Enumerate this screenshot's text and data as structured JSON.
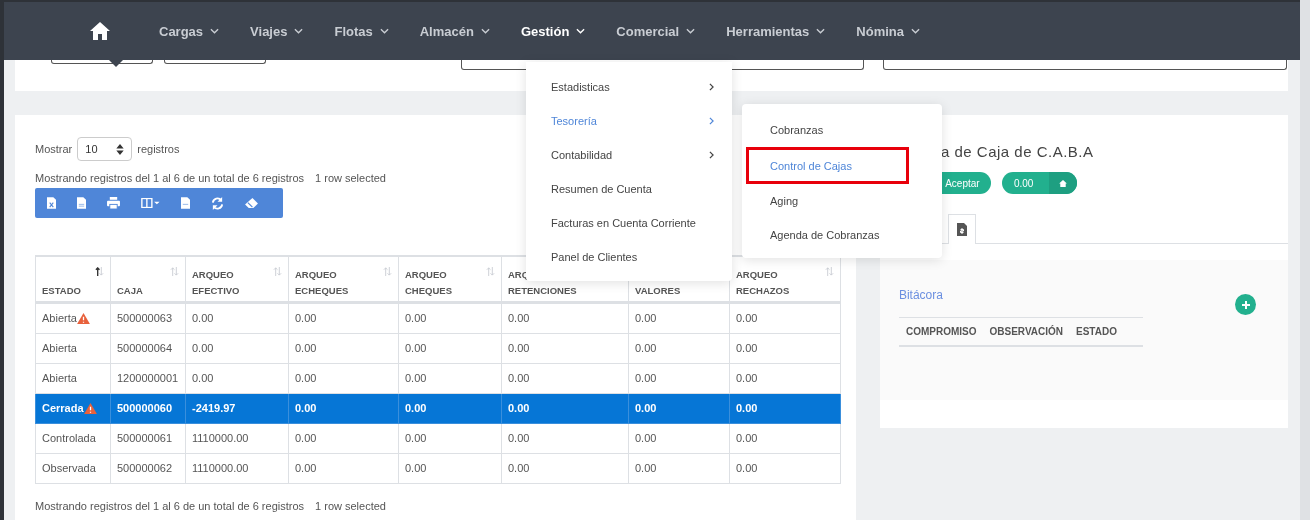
{
  "nav": {
    "items": [
      {
        "label": "Cargas",
        "selected": false
      },
      {
        "label": "Viajes",
        "selected": false
      },
      {
        "label": "Flotas",
        "selected": false
      },
      {
        "label": "Almacén",
        "selected": false
      },
      {
        "label": "Gestión",
        "selected": true
      },
      {
        "label": "Comercial",
        "selected": false
      },
      {
        "label": "Herramientas",
        "selected": false
      },
      {
        "label": "Nómina",
        "selected": false
      }
    ]
  },
  "gestion_menu": {
    "items": [
      {
        "label": "Estadisticas",
        "has_submenu": true,
        "selected": false
      },
      {
        "label": "Tesorería",
        "has_submenu": true,
        "selected": true
      },
      {
        "label": "Contabilidad",
        "has_submenu": true,
        "selected": false
      },
      {
        "label": "Resumen de Cuenta",
        "has_submenu": false,
        "selected": false
      },
      {
        "label": "Facturas en Cuenta Corriente",
        "has_submenu": false,
        "selected": false
      },
      {
        "label": "Panel de Clientes",
        "has_submenu": false,
        "selected": false
      }
    ]
  },
  "submenu": {
    "items": [
      {
        "label": "Cobranzas",
        "selected": false,
        "highlighted": false
      },
      {
        "label": "Control de Cajas",
        "selected": true,
        "highlighted": true
      },
      {
        "label": "Aging",
        "selected": false,
        "highlighted": false
      },
      {
        "label": "Agenda de Cobranzas",
        "selected": false,
        "highlighted": false
      }
    ]
  },
  "list": {
    "show_label": "Mostrar",
    "page_size": "10",
    "unit_label": "registros",
    "info": "Mostrando registros del 1 al 6 de un total de 6 registros",
    "selection": "1 row selected",
    "columns": [
      {
        "lines": [
          "ESTADO"
        ],
        "sorted": true
      },
      {
        "lines": [
          "CAJA"
        ],
        "sorted": false
      },
      {
        "lines": [
          "ARQUEO",
          "EFECTIVO"
        ],
        "sorted": false
      },
      {
        "lines": [
          "ARQUEO",
          "ECHEQUES"
        ],
        "sorted": false
      },
      {
        "lines": [
          "ARQUEO",
          "CHEQUES"
        ],
        "sorted": false
      },
      {
        "lines": [
          "ARQ",
          "RETENCIONES"
        ]
      },
      {
        "lines": [
          "VALORES"
        ]
      },
      {
        "lines": [
          "ARQUEO",
          "RECHAZOS"
        ],
        "sorted": false
      }
    ],
    "rows": [
      {
        "selected": false,
        "warning": true,
        "cells": [
          "Abierta",
          "500000063",
          "0.00",
          "0.00",
          "0.00",
          "0.00",
          "0.00",
          "0.00"
        ]
      },
      {
        "selected": false,
        "warning": false,
        "cells": [
          "Abierta",
          "500000064",
          "0.00",
          "0.00",
          "0.00",
          "0.00",
          "0.00",
          "0.00"
        ]
      },
      {
        "selected": false,
        "warning": false,
        "cells": [
          "Abierta",
          "1200000001",
          "0.00",
          "0.00",
          "0.00",
          "0.00",
          "0.00",
          "0.00"
        ]
      },
      {
        "selected": true,
        "warning": true,
        "cells": [
          "Cerrada",
          "500000060",
          "-2419.97",
          "0.00",
          "0.00",
          "0.00",
          "0.00",
          "0.00"
        ]
      },
      {
        "selected": false,
        "warning": false,
        "cells": [
          "Controlada",
          "500000061",
          "1110000.00",
          "0.00",
          "0.00",
          "0.00",
          "0.00",
          "0.00"
        ]
      },
      {
        "selected": false,
        "warning": false,
        "cells": [
          "Observada",
          "500000062",
          "1110000.00",
          "0.00",
          "0.00",
          "0.00",
          "0.00",
          "0.00"
        ]
      }
    ],
    "footer_info": "Mostrando registros del 1 al 6 de un total de 6 registros",
    "footer_selection": "1 row selected"
  },
  "detail": {
    "title": "a de Caja de C.A.B.A",
    "accept_button": "Aceptar",
    "amount": "0.00",
    "section": "Bitácora",
    "columns": [
      "COMPROMISO",
      "OBSERVACIÓN",
      "ESTADO"
    ]
  }
}
